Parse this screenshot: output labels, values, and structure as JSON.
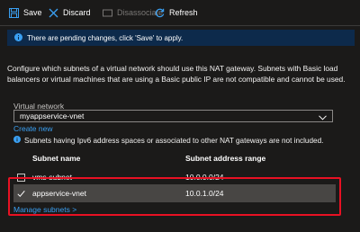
{
  "toolbar": {
    "save": "Save",
    "discard": "Discard",
    "disassociate": "Disassociate",
    "refresh": "Refresh"
  },
  "banner": {
    "text": "There are pending changes, click 'Save' to apply."
  },
  "description": "Configure which subnets of a virtual network should use this NAT gateway. Subnets with Basic load balancers or virtual machines that are using a Basic public IP are not compatible and cannot be used.",
  "vnet": {
    "label": "Virtual network",
    "value": "myappservice-vnet",
    "create_new": "Create new"
  },
  "note": "Subnets having Ipv6 address spaces or associated to other NAT gateways are not included.",
  "table": {
    "columns": [
      "Subnet name",
      "Subnet address range"
    ],
    "rows": [
      {
        "name": "vms-subnet",
        "range": "10.0.0.0/24",
        "selected": false
      },
      {
        "name": "appservice-vnet",
        "range": "10.0.1.0/24",
        "selected": true
      }
    ]
  },
  "manage_subnets": "Manage subnets >",
  "colors": {
    "background": "#1b1a19",
    "link": "#3aa0f3",
    "banner": "#0d2a4b",
    "highlight": "#e81123",
    "selected_row": "#484644"
  }
}
